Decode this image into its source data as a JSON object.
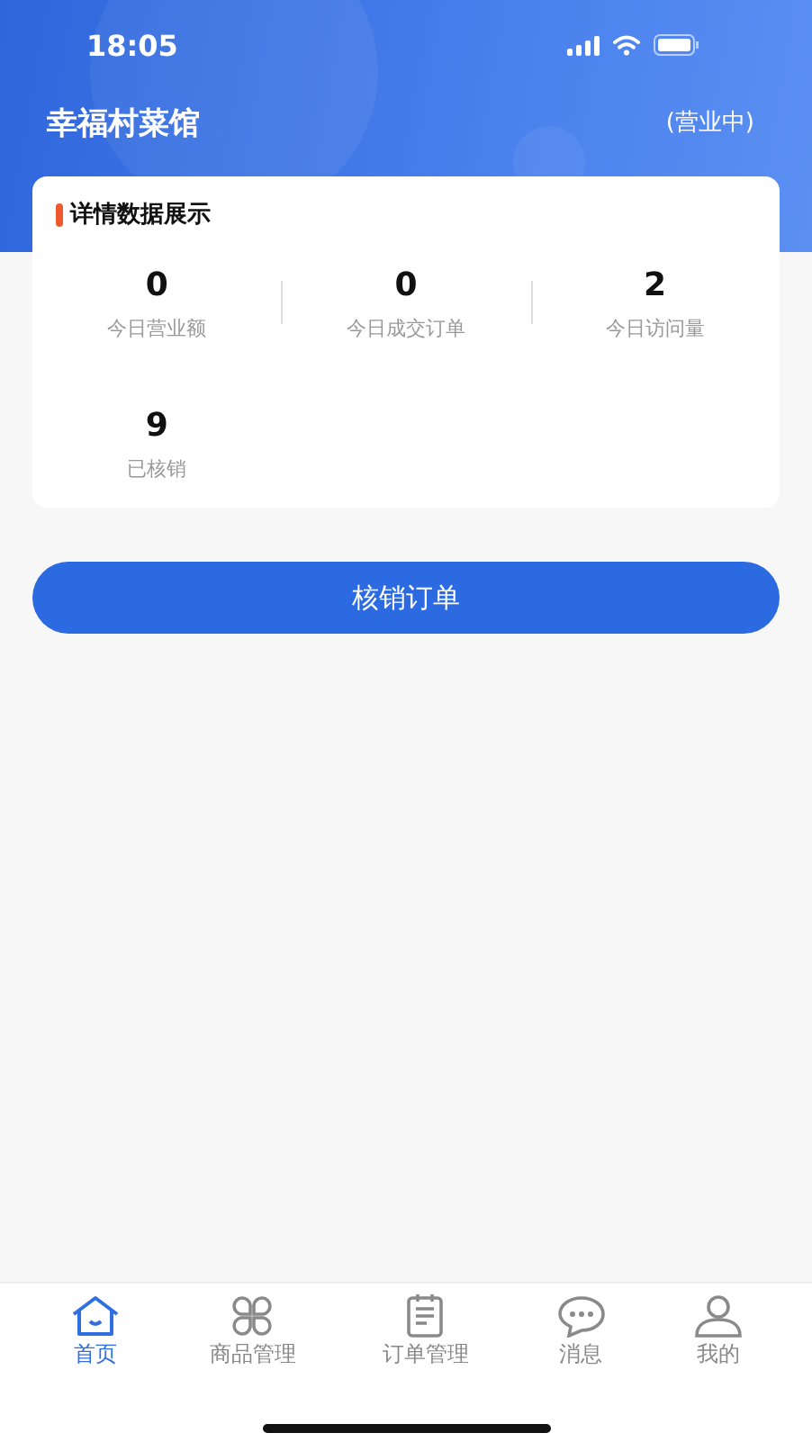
{
  "status_bar": {
    "time": "18:05"
  },
  "header": {
    "title": "幸福村菜馆",
    "status": "(营业中)"
  },
  "stats_card": {
    "title": "详情数据展示",
    "stats": [
      {
        "value": "0",
        "label": "今日营业额"
      },
      {
        "value": "0",
        "label": "今日成交订单"
      },
      {
        "value": "2",
        "label": "今日访问量"
      },
      {
        "value": "9",
        "label": "已核销"
      }
    ]
  },
  "action_button": {
    "label": "核销订单"
  },
  "tab_bar": [
    {
      "kind": "home",
      "label": "首页",
      "selected": true
    },
    {
      "kind": "products",
      "label": "商品管理",
      "selected": false
    },
    {
      "kind": "orders",
      "label": "订单管理",
      "selected": false
    },
    {
      "kind": "messages",
      "label": "消息",
      "selected": false
    },
    {
      "kind": "profile",
      "label": "我的",
      "selected": false
    }
  ]
}
